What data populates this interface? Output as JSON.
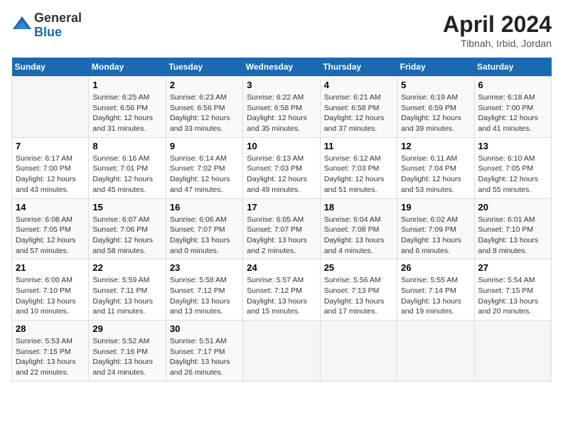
{
  "header": {
    "logo_general": "General",
    "logo_blue": "Blue",
    "month_title": "April 2024",
    "location": "Tibnah, Irbid, Jordan"
  },
  "days_of_week": [
    "Sunday",
    "Monday",
    "Tuesday",
    "Wednesday",
    "Thursday",
    "Friday",
    "Saturday"
  ],
  "weeks": [
    [
      {
        "day": "",
        "info": ""
      },
      {
        "day": "1",
        "info": "Sunrise: 6:25 AM\nSunset: 6:56 PM\nDaylight: 12 hours\nand 31 minutes."
      },
      {
        "day": "2",
        "info": "Sunrise: 6:23 AM\nSunset: 6:56 PM\nDaylight: 12 hours\nand 33 minutes."
      },
      {
        "day": "3",
        "info": "Sunrise: 6:22 AM\nSunset: 6:58 PM\nDaylight: 12 hours\nand 35 minutes."
      },
      {
        "day": "4",
        "info": "Sunrise: 6:21 AM\nSunset: 6:58 PM\nDaylight: 12 hours\nand 37 minutes."
      },
      {
        "day": "5",
        "info": "Sunrise: 6:19 AM\nSunset: 6:59 PM\nDaylight: 12 hours\nand 39 minutes."
      },
      {
        "day": "6",
        "info": "Sunrise: 6:18 AM\nSunset: 7:00 PM\nDaylight: 12 hours\nand 41 minutes."
      }
    ],
    [
      {
        "day": "7",
        "info": "Sunrise: 6:17 AM\nSunset: 7:00 PM\nDaylight: 12 hours\nand 43 minutes."
      },
      {
        "day": "8",
        "info": "Sunrise: 6:16 AM\nSunset: 7:01 PM\nDaylight: 12 hours\nand 45 minutes."
      },
      {
        "day": "9",
        "info": "Sunrise: 6:14 AM\nSunset: 7:02 PM\nDaylight: 12 hours\nand 47 minutes."
      },
      {
        "day": "10",
        "info": "Sunrise: 6:13 AM\nSunset: 7:03 PM\nDaylight: 12 hours\nand 49 minutes."
      },
      {
        "day": "11",
        "info": "Sunrise: 6:12 AM\nSunset: 7:03 PM\nDaylight: 12 hours\nand 51 minutes."
      },
      {
        "day": "12",
        "info": "Sunrise: 6:11 AM\nSunset: 7:04 PM\nDaylight: 12 hours\nand 53 minutes."
      },
      {
        "day": "13",
        "info": "Sunrise: 6:10 AM\nSunset: 7:05 PM\nDaylight: 12 hours\nand 55 minutes."
      }
    ],
    [
      {
        "day": "14",
        "info": "Sunrise: 6:08 AM\nSunset: 7:05 PM\nDaylight: 12 hours\nand 57 minutes."
      },
      {
        "day": "15",
        "info": "Sunrise: 6:07 AM\nSunset: 7:06 PM\nDaylight: 12 hours\nand 58 minutes."
      },
      {
        "day": "16",
        "info": "Sunrise: 6:06 AM\nSunset: 7:07 PM\nDaylight: 13 hours\nand 0 minutes."
      },
      {
        "day": "17",
        "info": "Sunrise: 6:05 AM\nSunset: 7:07 PM\nDaylight: 13 hours\nand 2 minutes."
      },
      {
        "day": "18",
        "info": "Sunrise: 6:04 AM\nSunset: 7:08 PM\nDaylight: 13 hours\nand 4 minutes."
      },
      {
        "day": "19",
        "info": "Sunrise: 6:02 AM\nSunset: 7:09 PM\nDaylight: 13 hours\nand 6 minutes."
      },
      {
        "day": "20",
        "info": "Sunrise: 6:01 AM\nSunset: 7:10 PM\nDaylight: 13 hours\nand 8 minutes."
      }
    ],
    [
      {
        "day": "21",
        "info": "Sunrise: 6:00 AM\nSunset: 7:10 PM\nDaylight: 13 hours\nand 10 minutes."
      },
      {
        "day": "22",
        "info": "Sunrise: 5:59 AM\nSunset: 7:11 PM\nDaylight: 13 hours\nand 11 minutes."
      },
      {
        "day": "23",
        "info": "Sunrise: 5:58 AM\nSunset: 7:12 PM\nDaylight: 13 hours\nand 13 minutes."
      },
      {
        "day": "24",
        "info": "Sunrise: 5:57 AM\nSunset: 7:12 PM\nDaylight: 13 hours\nand 15 minutes."
      },
      {
        "day": "25",
        "info": "Sunrise: 5:56 AM\nSunset: 7:13 PM\nDaylight: 13 hours\nand 17 minutes."
      },
      {
        "day": "26",
        "info": "Sunrise: 5:55 AM\nSunset: 7:14 PM\nDaylight: 13 hours\nand 19 minutes."
      },
      {
        "day": "27",
        "info": "Sunrise: 5:54 AM\nSunset: 7:15 PM\nDaylight: 13 hours\nand 20 minutes."
      }
    ],
    [
      {
        "day": "28",
        "info": "Sunrise: 5:53 AM\nSunset: 7:15 PM\nDaylight: 13 hours\nand 22 minutes."
      },
      {
        "day": "29",
        "info": "Sunrise: 5:52 AM\nSunset: 7:16 PM\nDaylight: 13 hours\nand 24 minutes."
      },
      {
        "day": "30",
        "info": "Sunrise: 5:51 AM\nSunset: 7:17 PM\nDaylight: 13 hours\nand 26 minutes."
      },
      {
        "day": "",
        "info": ""
      },
      {
        "day": "",
        "info": ""
      },
      {
        "day": "",
        "info": ""
      },
      {
        "day": "",
        "info": ""
      }
    ]
  ]
}
